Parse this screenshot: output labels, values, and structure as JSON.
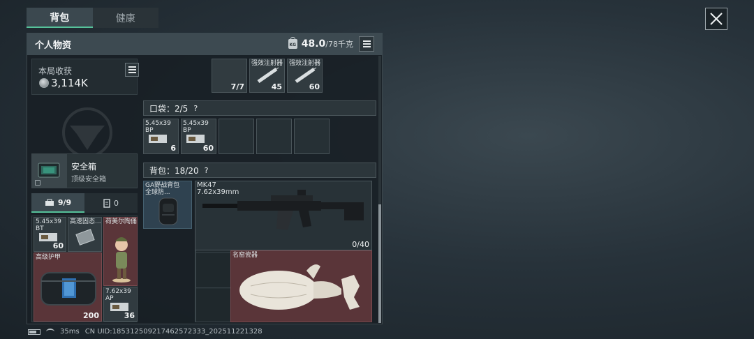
{
  "tabs": [
    {
      "label": "背包",
      "active": true
    },
    {
      "label": "健康",
      "active": false
    }
  ],
  "header": {
    "title": "个人物资",
    "weight_current": "48.0",
    "weight_max": "/78千克",
    "weight_icon_text": "KG"
  },
  "loot": {
    "label": "本局收获",
    "value": "3,114K"
  },
  "safe": {
    "title": "安全箱",
    "subtitle": "顶级安全箱"
  },
  "sub_tabs": [
    {
      "label": "9/9",
      "icon": "toolbox-icon",
      "active": true
    },
    {
      "label": "0",
      "icon": "card-case-icon",
      "active": false
    }
  ],
  "safe_items": [
    {
      "name": "5.45x39\nBT",
      "qty": "60"
    },
    {
      "name": "高速固态...",
      "qty": ""
    },
    {
      "name": "荷美尔陶俑",
      "qty": ""
    },
    {
      "name": "高级护甲",
      "qty": "200"
    },
    {
      "name": "7.62x39\nAP",
      "qty": "36"
    }
  ],
  "top_items": [
    {
      "name": "",
      "qty": "7/7"
    },
    {
      "name": "强效注射器",
      "qty": "45"
    },
    {
      "name": "强效注射器",
      "qty": "60"
    }
  ],
  "pocket": {
    "label": "口袋：2/5",
    "items": [
      {
        "name": "5.45x39\nBP",
        "qty": "6"
      },
      {
        "name": "5.45x39\nBP",
        "qty": "60"
      }
    ]
  },
  "backpack": {
    "label": "背包：18/20",
    "bag_name": "GA野战背包",
    "bag_sub": "全球防...",
    "weapon_name": "MK47",
    "weapon_ammo_type": "7.62x39mm",
    "weapon_ammo": "0/40",
    "vase_name": "名窑瓷器"
  },
  "question_mark": "?",
  "footer": {
    "ping": "35ms",
    "uid": "CN UID:18531250921746257​2333_202511221328"
  },
  "colors": {
    "accent": "#56c29a",
    "rare_red": "#5a3539",
    "blue_item": "#2f4250"
  }
}
